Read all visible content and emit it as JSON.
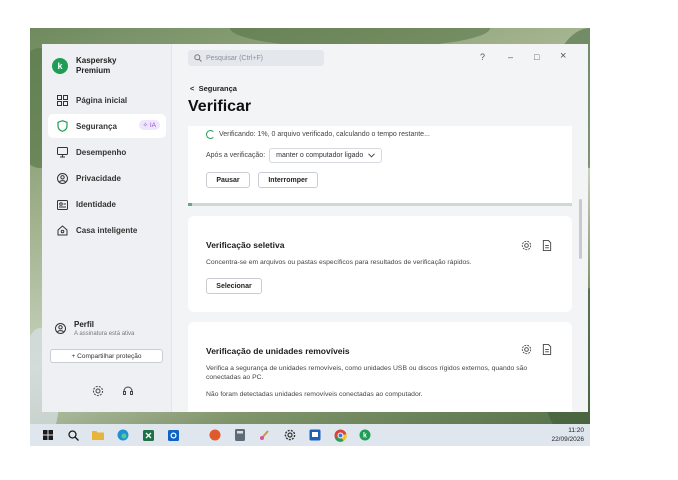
{
  "app": {
    "brand_line1": "Kaspersky",
    "brand_line2": "Premium",
    "logo_letter": "k",
    "accent": "#1f9d55"
  },
  "search": {
    "placeholder": "Pesquisar (Ctrl+F)"
  },
  "window_controls": {
    "help": "?",
    "minimize": "–",
    "maximize": "□",
    "close": "×"
  },
  "sidebar": {
    "items": [
      {
        "label": "Página inicial",
        "icon": "home-grid-icon"
      },
      {
        "label": "Segurança",
        "icon": "shield-icon",
        "badge": "IA",
        "active": true
      },
      {
        "label": "Desempenho",
        "icon": "monitor-icon"
      },
      {
        "label": "Privacidade",
        "icon": "privacy-icon"
      },
      {
        "label": "Identidade",
        "icon": "id-card-icon"
      },
      {
        "label": "Casa inteligente",
        "icon": "smart-home-icon"
      }
    ],
    "profile": {
      "name": "Perfil",
      "subtitle": "A assinatura está ativa"
    },
    "share_label": "+ Compartilhar proteção",
    "bottom_icons": [
      "settings-icon",
      "headset-icon"
    ]
  },
  "breadcrumb": {
    "back": "<",
    "label": "Segurança"
  },
  "page_title": "Verificar",
  "scan": {
    "status": "Verificando: 1%, 0 arquivo verificado, calculando o tempo restante...",
    "after_label": "Após a verificação:",
    "after_value": "manter o computador ligado",
    "pause_label": "Pausar",
    "stop_label": "Interromper",
    "progress": 0.01
  },
  "selective": {
    "title": "Verificação seletiva",
    "description": "Concentra-se em arquivos ou pastas específicos para resultados de verificação rápidos.",
    "select_label": "Selecionar"
  },
  "removable": {
    "title": "Verificação de unidades removíveis",
    "description": "Verifica a segurança de unidades removíveis, como unidades USB ou discos rígidos externos, quando são conectadas ao PC.",
    "status": "Não foram detectadas unidades removíveis conectadas ao computador."
  },
  "taskbar": {
    "icons": [
      "windows-start-icon",
      "search-icon",
      "file-explorer-icon",
      "edge-icon",
      "excel-icon",
      "outlook-icon",
      "app-red-icon",
      "calculator-icon",
      "paint-icon",
      "settings-icon",
      "photos-icon",
      "chrome-icon",
      "kaspersky-icon"
    ],
    "time": "11:20",
    "date": "22/09/2026"
  }
}
